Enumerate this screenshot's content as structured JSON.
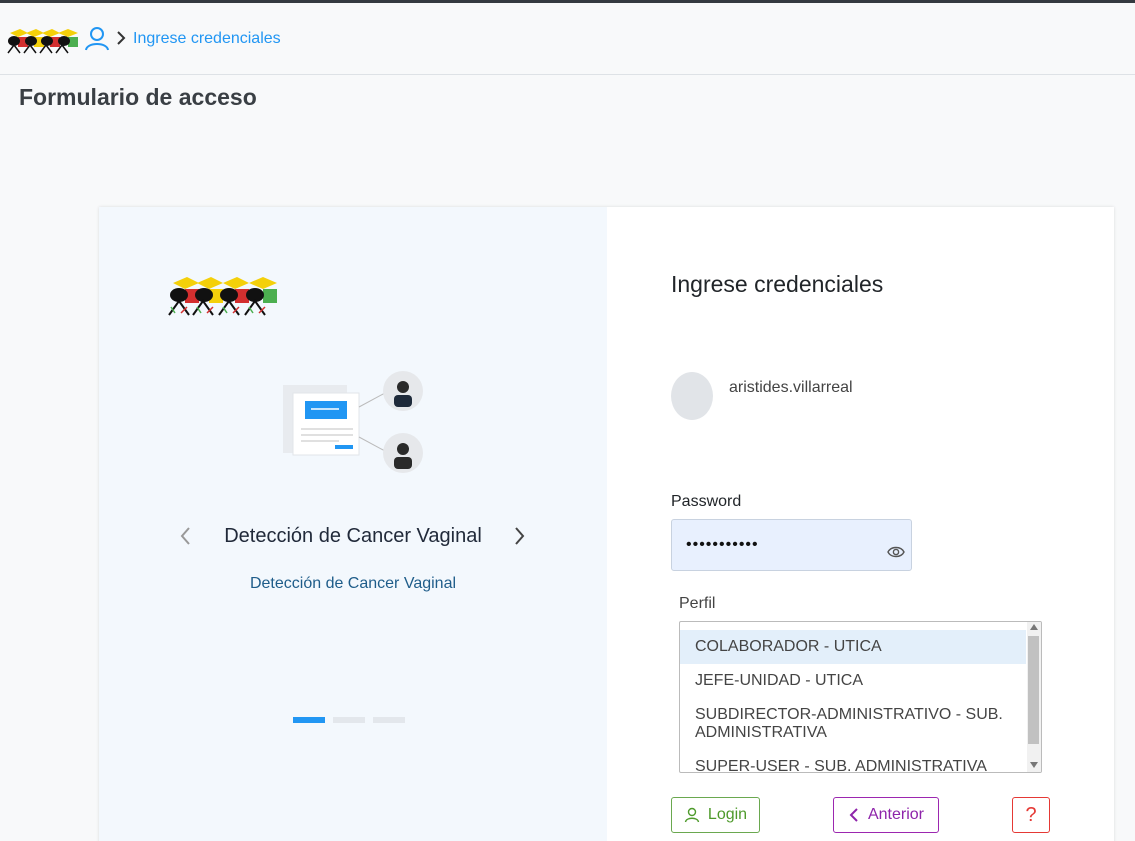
{
  "header": {
    "breadcrumb_current": "Ingrese credenciales",
    "logo_icon": "ants-logo-icon",
    "user_icon": "user-icon",
    "separator_icon": "chevron-right-icon"
  },
  "page": {
    "title": "Formulario de acceso"
  },
  "carousel": {
    "title": "Detección de Cancer Vaginal",
    "subtitle": "Detección de Cancer Vaginal",
    "prev_icon": "chevron-left-icon",
    "next_icon": "chevron-right-icon",
    "active_index": 0,
    "slide_count": 3
  },
  "form": {
    "title": "Ingrese credenciales",
    "username": "aristides.villarreal",
    "password_label": "Password",
    "password_value": "•••••••••••",
    "perfil_label": "Perfil",
    "perfil_options": [
      "COLABORADOR - UTICA",
      "JEFE-UNIDAD - UTICA",
      "SUBDIRECTOR-ADMINISTRATIVO - SUB. ADMINISTRATIVA",
      "SUPER-USER - SUB. ADMINISTRATIVA"
    ],
    "perfil_selected": "COLABORADOR - UTICA",
    "login_label": "Login",
    "prev_label": "Anterior",
    "help_label": "?"
  },
  "colors": {
    "accent": "#2196f3",
    "login": "#4e9a2b",
    "prev": "#8e24aa",
    "help": "#e53935"
  }
}
